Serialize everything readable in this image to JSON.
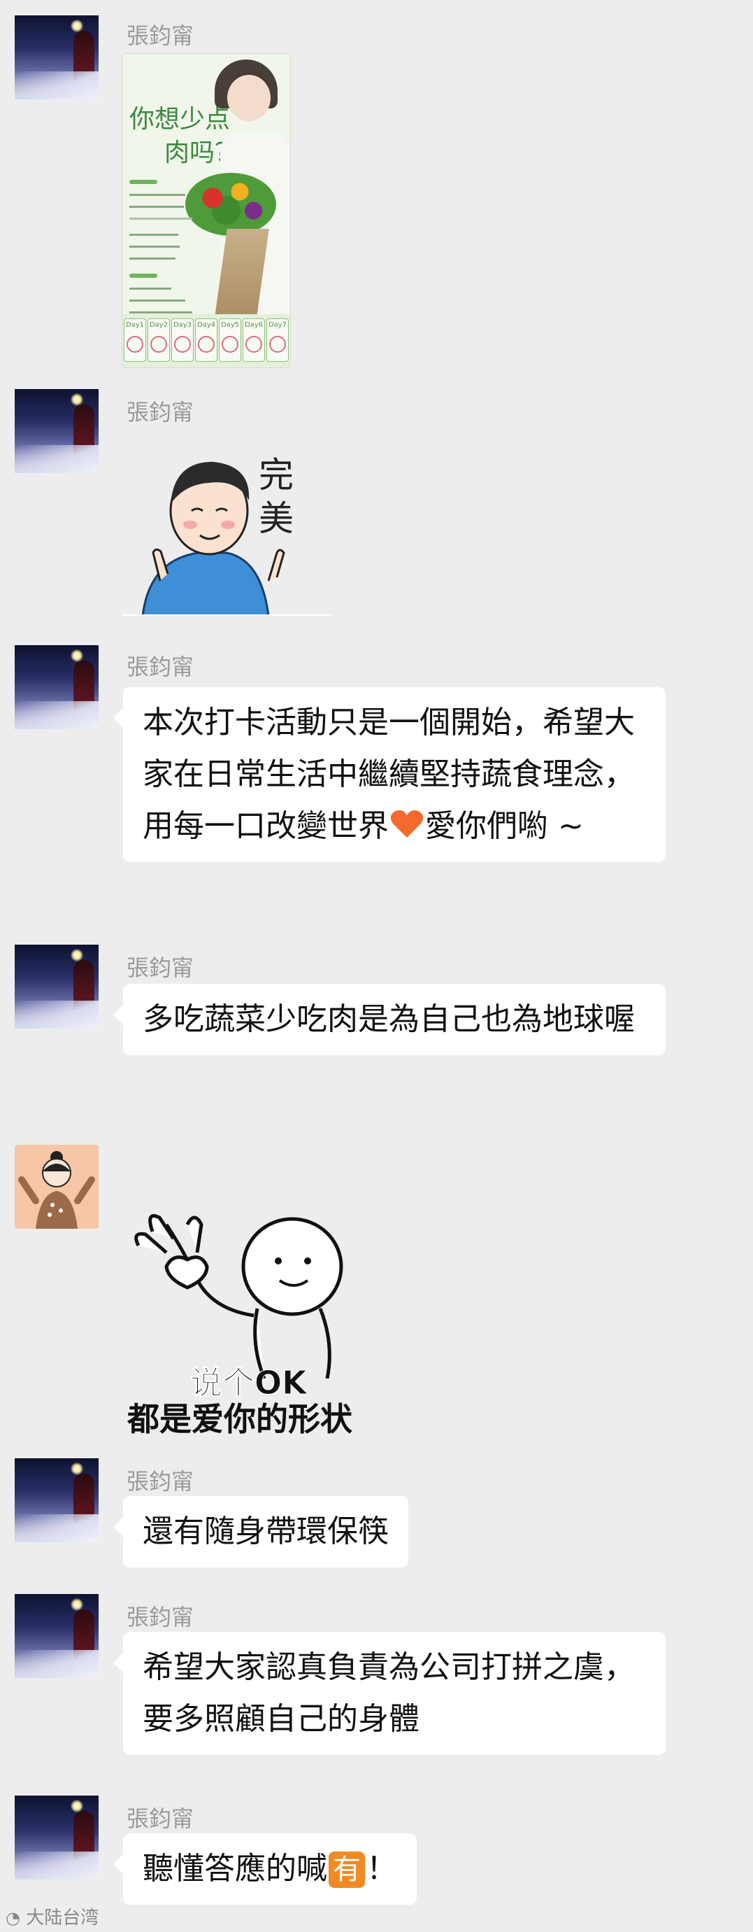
{
  "sender_name": "張鈞甯",
  "poster": {
    "title_line1": "你想少点",
    "title_line2": "肉吗？",
    "day_labels": [
      "Day1",
      "Day2",
      "Day3",
      "Day4",
      "Day5",
      "Day6",
      "Day7"
    ]
  },
  "sticker_perfect": {
    "text": "完美"
  },
  "sticker_ok": {
    "line1": "说个OK",
    "line2": "都是爱你的形状"
  },
  "messages": {
    "m3": "本次打卡活動只是一個開始，希望大家在日常生活中繼續堅持蔬食理念，用每一口改變世界",
    "m3_tail": "愛你們喲 ~",
    "m4": "多吃蔬菜少吃肉是為自己也為地球喔",
    "m5": "還有隨身帶環保筷",
    "m6": "希望大家認真負責為公司打拼之虞，要多照顧自己的身體",
    "m7_a": "聽懂答應的喊",
    "m7_emoji": "有",
    "m7_b": "！"
  },
  "watermark": "大陆台湾",
  "colors": {
    "background": "#ededed",
    "bubble": "#ffffff",
    "name": "#9a9a9a",
    "heart": "#f26a2e",
    "you_badge": "#f08a24"
  },
  "icons": [
    "avatar-photo",
    "heart-emoji",
    "you-emoji-badge"
  ]
}
